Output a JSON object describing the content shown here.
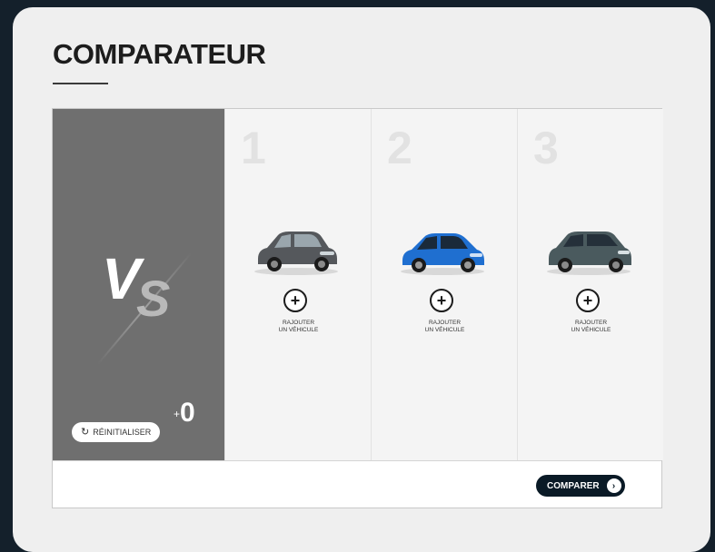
{
  "page": {
    "title": "COMPARATEUR"
  },
  "vs_panel": {
    "vs_first": "V",
    "vs_second": "S",
    "reset_label": "RÉINITIALISER",
    "reset_icon": "refresh-icon",
    "counter_prefix": "+",
    "counter": "0"
  },
  "slots": [
    {
      "number": "1",
      "add_label_line1": "RAJOUTER",
      "add_label_line2": "UN VÉHICULE",
      "car_color": "#55585c"
    },
    {
      "number": "2",
      "add_label_line1": "RAJOUTER",
      "add_label_line2": "UN VÉHICULE",
      "car_color": "#1f6fd0"
    },
    {
      "number": "3",
      "add_label_line1": "RAJOUTER",
      "add_label_line2": "UN VÉHICULE",
      "car_color": "#4a5a5e"
    }
  ],
  "footer": {
    "compare_label": "COMPARER",
    "compare_icon": "chevron-right-icon"
  },
  "colors": {
    "background": "#14202b",
    "vs_panel": "#6f6f6f",
    "compare_button": "#0a1a26"
  }
}
